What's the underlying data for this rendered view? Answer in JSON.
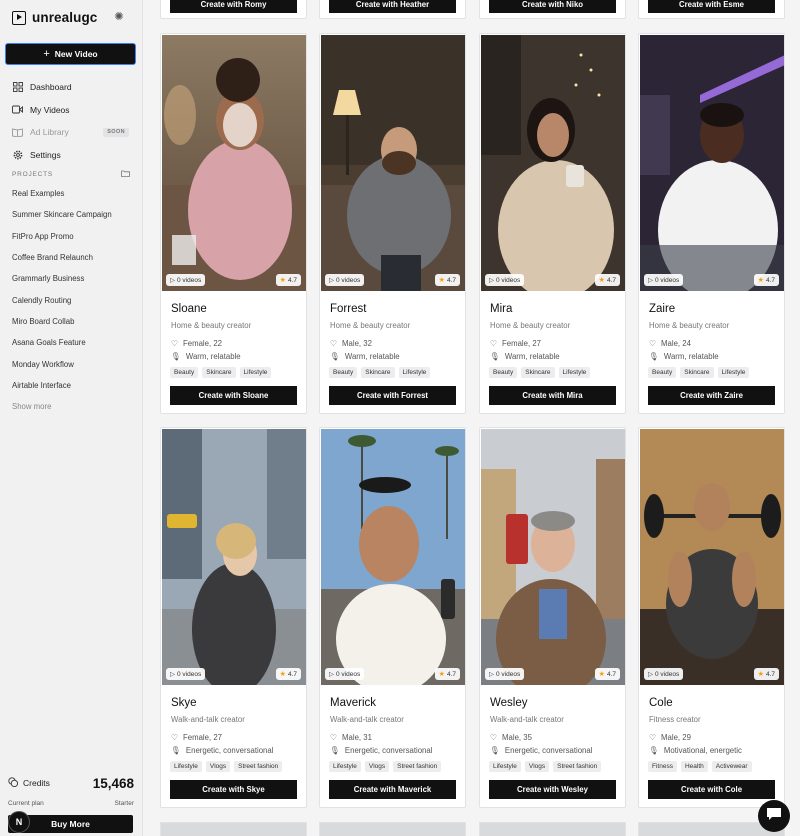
{
  "app": {
    "name": "unrealugc"
  },
  "sidebar": {
    "new_video": "New Video",
    "nav": [
      {
        "label": "Dashboard",
        "icon": "dashboard-icon"
      },
      {
        "label": "My Videos",
        "icon": "video-icon"
      },
      {
        "label": "Ad Library",
        "icon": "book-icon",
        "badge": "SOON"
      },
      {
        "label": "Settings",
        "icon": "gear-icon"
      }
    ],
    "projects_heading": "PROJECTS",
    "projects": [
      "Real Examples",
      "Summer Skincare Campaign",
      "FitPro App Promo",
      "Coffee Brand Relaunch",
      "Grammarly Business",
      "Calendly Routing",
      "Miro Board Collab",
      "Asana Goals Feature",
      "Monday Workflow",
      "Airtable Interface",
      "Show more"
    ],
    "credits_label": "Credits",
    "credits_value": "15,468",
    "plan_label": "Current plan",
    "plan_value": "Starter",
    "buy_more": "Buy More",
    "badge_letter": "N"
  },
  "top_buttons": [
    "Create with Romy",
    "Create with Heather",
    "Create with Niko",
    "Create with Esme"
  ],
  "creators": [
    {
      "name": "Sloane",
      "role": "Home & beauty creator",
      "demo": "Female, 22",
      "tone": "Warm, relatable",
      "tags": [
        "Beauty",
        "Skincare",
        "Lifestyle"
      ],
      "videos": "0 videos",
      "rating": "4.7",
      "cta": "Create with Sloane"
    },
    {
      "name": "Forrest",
      "role": "Home & beauty creator",
      "demo": "Male, 32",
      "tone": "Warm, relatable",
      "tags": [
        "Beauty",
        "Skincare",
        "Lifestyle"
      ],
      "videos": "0 videos",
      "rating": "4.7",
      "cta": "Create with Forrest"
    },
    {
      "name": "Mira",
      "role": "Home & beauty creator",
      "demo": "Female, 27",
      "tone": "Warm, relatable",
      "tags": [
        "Beauty",
        "Skincare",
        "Lifestyle"
      ],
      "videos": "0 videos",
      "rating": "4.7",
      "cta": "Create with Mira"
    },
    {
      "name": "Zaire",
      "role": "Home & beauty creator",
      "demo": "Male, 24",
      "tone": "Warm, relatable",
      "tags": [
        "Beauty",
        "Skincare",
        "Lifestyle"
      ],
      "videos": "0 videos",
      "rating": "4.7",
      "cta": "Create with Zaire"
    },
    {
      "name": "Skye",
      "role": "Walk-and-talk creator",
      "demo": "Female, 27",
      "tone": "Energetic, conversational",
      "tags": [
        "Lifestyle",
        "Vlogs",
        "Street fashion"
      ],
      "videos": "0 videos",
      "rating": "4.7",
      "cta": "Create with Skye"
    },
    {
      "name": "Maverick",
      "role": "Walk-and-talk creator",
      "demo": "Male, 31",
      "tone": "Energetic, conversational",
      "tags": [
        "Lifestyle",
        "Vlogs",
        "Street fashion"
      ],
      "videos": "0 videos",
      "rating": "4.7",
      "cta": "Create with Maverick"
    },
    {
      "name": "Wesley",
      "role": "Walk-and-talk creator",
      "demo": "Male, 35",
      "tone": "Energetic, conversational",
      "tags": [
        "Lifestyle",
        "Vlogs",
        "Street fashion"
      ],
      "videos": "0 videos",
      "rating": "4.7",
      "cta": "Create with Wesley"
    },
    {
      "name": "Cole",
      "role": "Fitness creator",
      "demo": "Male, 29",
      "tone": "Motivational, energetic",
      "tags": [
        "Fitness",
        "Health",
        "Activewear"
      ],
      "videos": "0 videos",
      "rating": "4.7",
      "cta": "Create with Cole"
    }
  ],
  "colors": {
    "accent": "#111111",
    "focus_ring": "#3b82f6",
    "star": "#f59e0b"
  }
}
